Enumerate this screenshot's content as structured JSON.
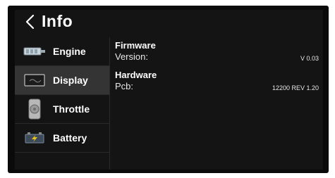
{
  "header": {
    "title": "Info",
    "back_icon": "chevron-left-icon"
  },
  "sidebar": {
    "items": [
      {
        "label": "Engine",
        "icon": "engine-icon",
        "active": false
      },
      {
        "label": "Display",
        "icon": "display-icon",
        "active": true
      },
      {
        "label": "Throttle",
        "icon": "throttle-icon",
        "active": false
      },
      {
        "label": "Battery",
        "icon": "battery-icon",
        "active": false
      }
    ]
  },
  "content": {
    "sections": [
      {
        "title": "Firmware",
        "label": "Version:",
        "value": "V 0.03"
      },
      {
        "title": "Hardware",
        "label": "Pcb:",
        "value": "12200 REV 1.20"
      }
    ]
  },
  "colors": {
    "background": "#141414",
    "active_item": "#343434",
    "text": "#ffffff",
    "battery_accent": "#e8c21a"
  }
}
